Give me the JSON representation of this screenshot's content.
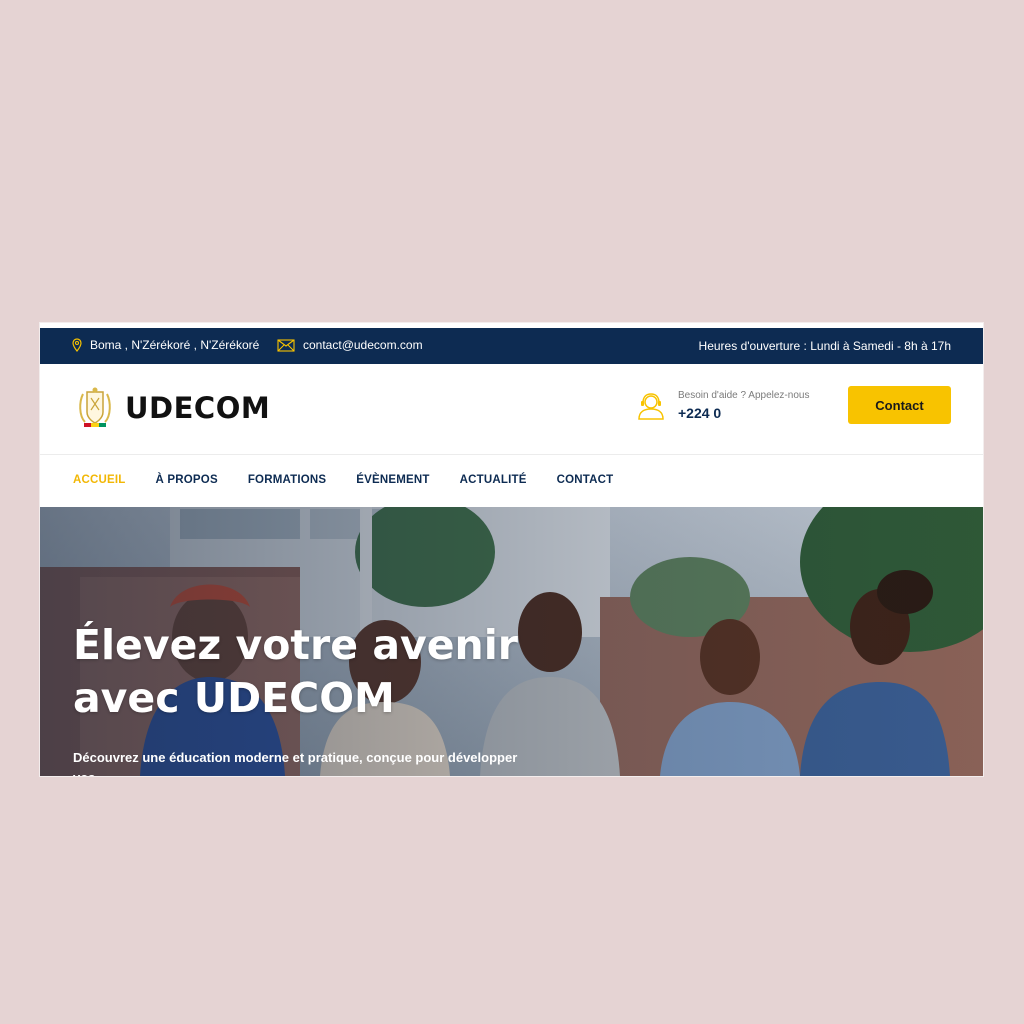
{
  "topbar": {
    "address": "Boma , N'Zérékoré , N'Zérékoré",
    "email": "contact@udecom.com",
    "hours": "Heures d'ouverture : Lundi à Samedi - 8h à 17h",
    "address_icon": "map-pin-icon",
    "email_icon": "envelope-icon"
  },
  "header": {
    "logo_text": "UDECOM",
    "help_label": "Besoin d'aide ? Appelez-nous",
    "phone": "+224 0",
    "help_icon": "support-agent-icon",
    "contact_button": "Contact"
  },
  "nav": {
    "items": [
      {
        "label": "ACCUEIL",
        "active": true
      },
      {
        "label": "À PROPOS",
        "active": false
      },
      {
        "label": "FORMATIONS",
        "active": false
      },
      {
        "label": "ÉVÈNEMENT",
        "active": false
      },
      {
        "label": "ACTUALITÉ",
        "active": false
      },
      {
        "label": "CONTACT",
        "active": false
      }
    ]
  },
  "hero": {
    "title_line1": "Élevez votre avenir",
    "title_line2": "avec UDECOM",
    "subtitle": "Découvrez une éducation moderne et pratique, conçue pour développer vos"
  },
  "colors": {
    "navy": "#0d2b52",
    "accent_yellow": "#f8c300",
    "page_background": "#e5d3d3"
  }
}
